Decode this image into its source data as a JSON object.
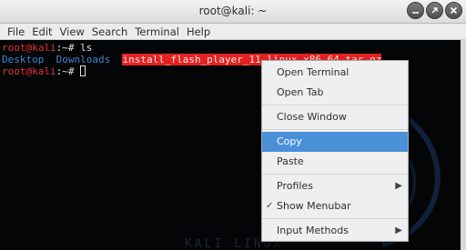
{
  "window": {
    "title": "root@kali: ~"
  },
  "menubar": [
    "File",
    "Edit",
    "View",
    "Search",
    "Terminal",
    "Help"
  ],
  "terminal": {
    "line1": {
      "prompt": "root@kali",
      "sep": ":~# ",
      "cmd": "ls"
    },
    "line2": {
      "dir1": "Desktop",
      "dir2": "Downloads",
      "file": "install_flash_player_11_linux.x86_64.tar.gz"
    },
    "line3": {
      "prompt": "root@kali",
      "sep": ":~# "
    },
    "watermark": "KALI LINUX"
  },
  "context_menu": {
    "open_terminal": "Open Terminal",
    "open_tab": "Open Tab",
    "close_window": "Close Window",
    "copy": "Copy",
    "paste": "Paste",
    "profiles": "Profiles",
    "show_menubar": "Show Menubar",
    "input_methods": "Input Methods",
    "selected_item": "Copy",
    "show_menubar_checked": true
  },
  "colors": {
    "terminal_bg": "#040507",
    "prompt_red": "#e83232",
    "dir_blue": "#3e86cf",
    "archive_highlight": "#e32222",
    "menu_selection": "#4a90d9"
  },
  "icons": [
    "minimize-icon",
    "maximize-icon",
    "close-icon",
    "check-icon",
    "chevron-right-icon"
  ]
}
